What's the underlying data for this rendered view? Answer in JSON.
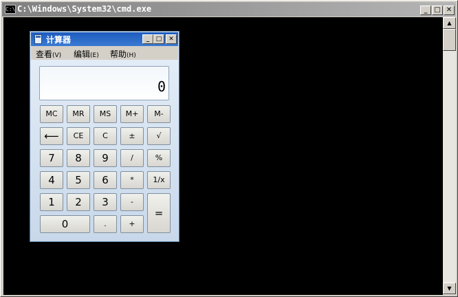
{
  "cmd": {
    "title": "C:\\Windows\\System32\\cmd.exe",
    "icon": "cmd-icon",
    "icon_text": "C:\\",
    "minimize_glyph": "_",
    "maximize_glyph": "□",
    "close_glyph": "✕"
  },
  "scrollbar": {
    "up_glyph": "▲",
    "down_glyph": "▼"
  },
  "calculator": {
    "title": "计算器",
    "minimize_glyph": "_",
    "maximize_glyph": "□",
    "close_glyph": "✕",
    "menu": [
      {
        "label": "查看",
        "accel": "(V)"
      },
      {
        "label": "编辑",
        "accel": "(E)"
      },
      {
        "label": "帮助",
        "accel": "(H)"
      }
    ],
    "display": "0",
    "memory_keys": [
      "MC",
      "MR",
      "MS",
      "M+",
      "M-"
    ],
    "row2": [
      "⟵",
      "CE",
      "C",
      "±",
      "√"
    ],
    "row3": [
      "7",
      "8",
      "9",
      "/",
      "%"
    ],
    "row4": [
      "4",
      "5",
      "6",
      "*",
      "1/x"
    ],
    "row5": [
      "1",
      "2",
      "3",
      "-"
    ],
    "row6": [
      "0",
      ".",
      "+"
    ],
    "equals": "="
  }
}
